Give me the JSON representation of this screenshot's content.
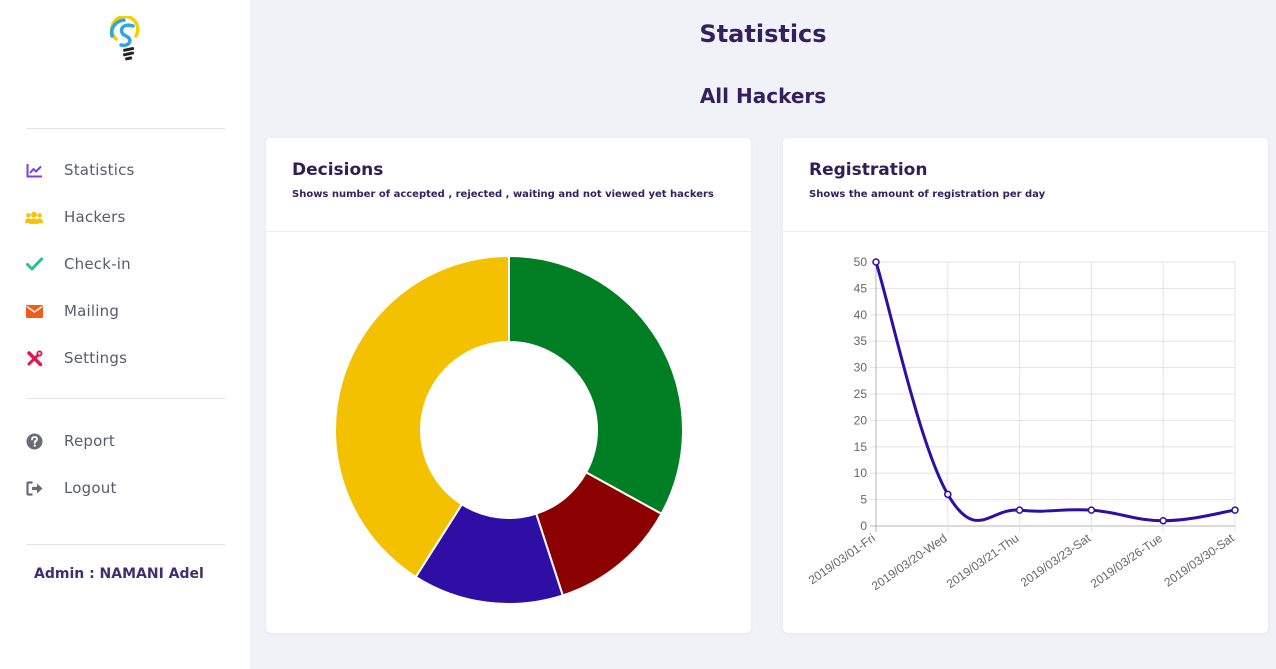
{
  "sidebar": {
    "items": [
      {
        "label": "Statistics",
        "icon": "chart-line-icon",
        "color": "#7b3fe4"
      },
      {
        "label": "Hackers",
        "icon": "users-icon",
        "color": "#f5c20a"
      },
      {
        "label": "Check-in",
        "icon": "check-icon",
        "color": "#22c48a"
      },
      {
        "label": "Mailing",
        "icon": "envelope-icon",
        "color": "#f25c1b"
      },
      {
        "label": "Settings",
        "icon": "tools-icon",
        "color": "#e8144f"
      },
      {
        "label": "Report",
        "icon": "question-circle-icon",
        "color": "#6b6b78"
      },
      {
        "label": "Logout",
        "icon": "sign-out-icon",
        "color": "#6b6b78"
      }
    ],
    "admin": "Admin : NAMANI Adel"
  },
  "header": {
    "title": "Statistics",
    "subtitle": "All Hackers"
  },
  "decisions": {
    "title": "Decisions",
    "description": "Shows number of accepted , rejected , waiting and not viewed yet hackers"
  },
  "registration": {
    "title": "Registration",
    "description": "Shows the amount of registration per day"
  },
  "chart_data": [
    {
      "type": "pie",
      "variant": "doughnut",
      "values": [
        33,
        12,
        14,
        41
      ],
      "colors": [
        "#007e24",
        "#8b0000",
        "#2f0ea5",
        "#f4c100"
      ]
    },
    {
      "type": "line",
      "categories": [
        "2019/03/01-Fri",
        "2019/03/20-Wed",
        "2019/03/21-Thu",
        "2019/03/23-Sat",
        "2019/03/26-Tue",
        "2019/03/30-Sat"
      ],
      "values": [
        50,
        6,
        3,
        3,
        1,
        3
      ],
      "ylim": [
        0,
        50
      ],
      "yticks": [
        0,
        5,
        10,
        15,
        20,
        25,
        30,
        35,
        40,
        45,
        50
      ],
      "grid": true,
      "color": "#2f0ea5"
    }
  ]
}
